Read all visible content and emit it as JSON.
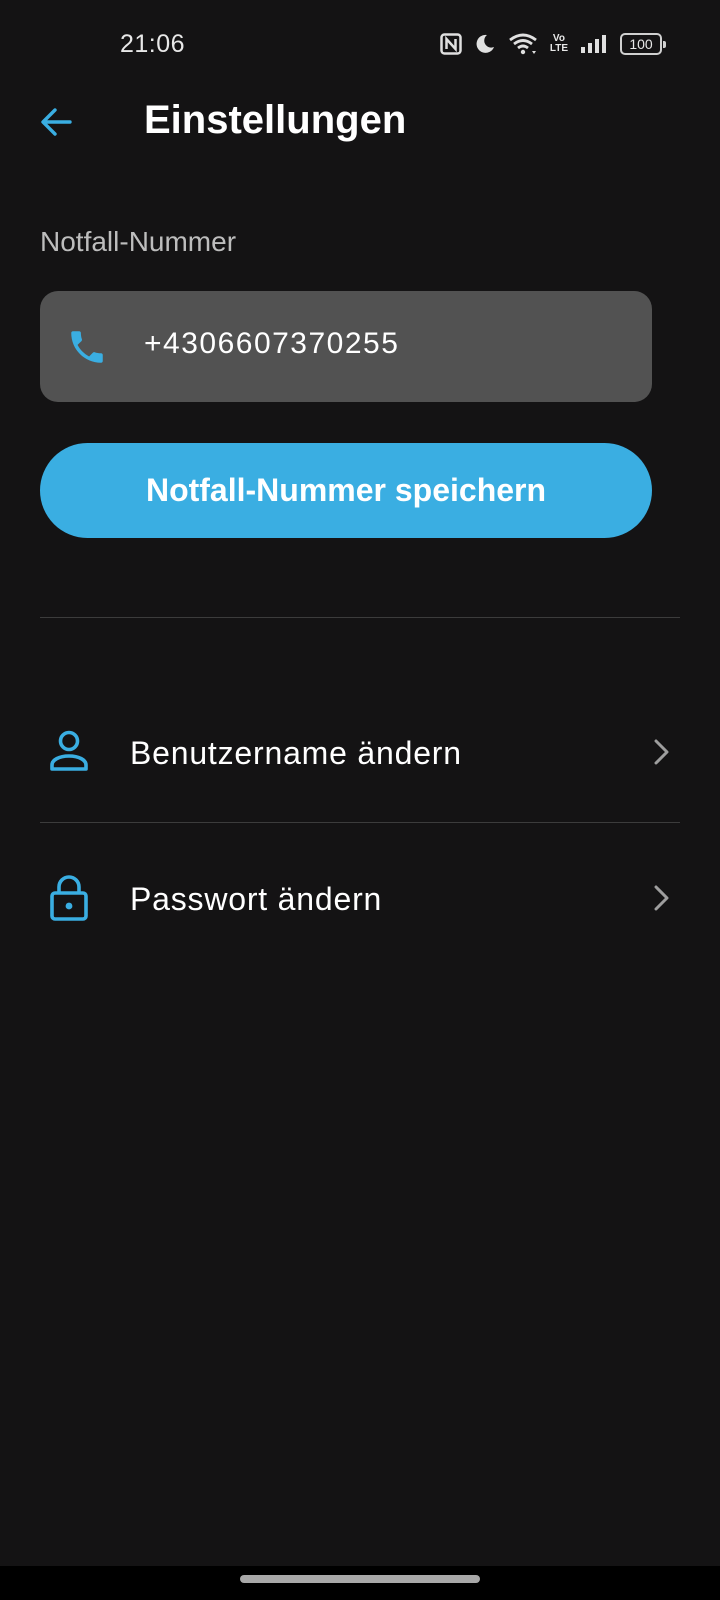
{
  "status_bar": {
    "time": "21:06",
    "battery": "100",
    "icons": [
      "nfc-icon",
      "moon-icon",
      "wifi-icon",
      "volte-icon",
      "signal-icon",
      "battery-icon"
    ],
    "volte_top": "Vo",
    "volte_bottom": "LTE"
  },
  "app_bar": {
    "title": "Einstellungen",
    "back_icon": "arrow-left-icon"
  },
  "emergency": {
    "label": "Notfall-Nummer",
    "phone_value": "+4306607370255",
    "phone_icon": "phone-icon",
    "save_label": "Notfall-Nummer speichern"
  },
  "settings_list": {
    "items": [
      {
        "label": "Benutzername ändern",
        "icon": "person-icon"
      },
      {
        "label": "Passwort ändern",
        "icon": "lock-icon"
      }
    ]
  },
  "colors": {
    "background": "#141314",
    "accent": "#3aaee2",
    "field": "#525252",
    "label": "#bdbdbd"
  }
}
